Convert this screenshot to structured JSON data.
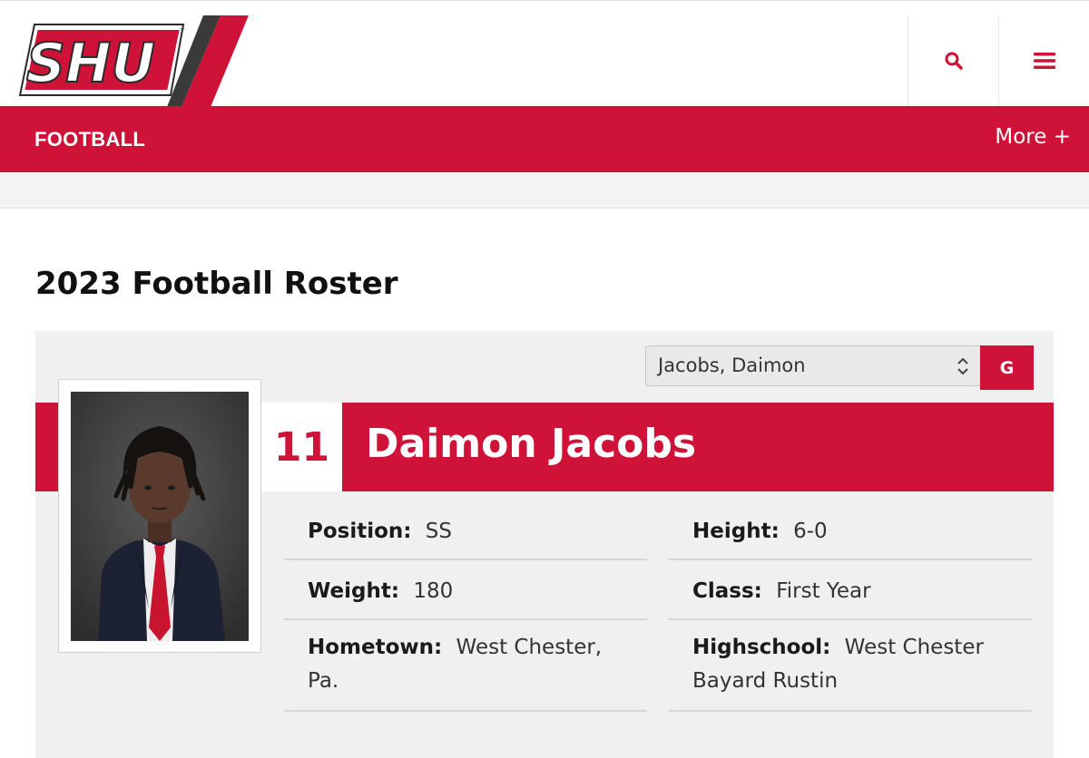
{
  "header": {
    "logo_text": "SHU",
    "search_icon": "search-icon",
    "menu_icon": "hamburger-menu-icon"
  },
  "nav": {
    "title": "FOOTBALL",
    "more_label": "More +"
  },
  "page": {
    "title": "2023 Football Roster"
  },
  "player_selector": {
    "selected": "Jacobs, Daimon",
    "go_label": "G"
  },
  "player": {
    "number": "11",
    "name": "Daimon Jacobs",
    "stats": {
      "position_label": "Position:",
      "position": "SS",
      "height_label": "Height:",
      "height": "6-0",
      "weight_label": "Weight:",
      "weight": "180",
      "class_label": "Class:",
      "class": "First Year",
      "hometown_label": "Hometown:",
      "hometown": "West Chester, Pa.",
      "highschool_label": "Highschool:",
      "highschool": "West Chester Bayard Rustin"
    }
  },
  "colors": {
    "brand_red": "#cf1238",
    "panel_gray": "#f0f0f0"
  }
}
